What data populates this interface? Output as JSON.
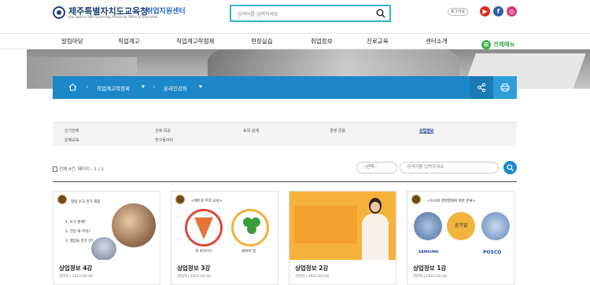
{
  "header": {
    "logo_ko": "제주특별자치도교육청",
    "logo_en": "Jeju Special Self-Governing Provincial Office of Education",
    "center_title": "취업지원센터",
    "search_placeholder": "검색어를 입력하세요",
    "login_label": "로그아웃",
    "sns": [
      {
        "name": "youtube",
        "glyph": "▶",
        "color": "#e02b20"
      },
      {
        "name": "facebook",
        "glyph": "f",
        "color": "#2d5faa"
      },
      {
        "name": "instagram",
        "glyph": "◎",
        "color": "#d8337a"
      }
    ]
  },
  "gnb": {
    "items": [
      "알림마당",
      "직업계고",
      "직업계고학점제",
      "현장실습",
      "취업정보",
      "진로교육",
      "센터소개"
    ],
    "all_menu": "전체메뉴"
  },
  "breadcrumb": {
    "level1": "직업계고학점제",
    "level2": "온라인강좌"
  },
  "categories": {
    "row1": [
      "인기전체",
      "건축 목공",
      "토목 설계",
      "경영 금융",
      "상업정보"
    ],
    "row2": [
      "원예교육",
      "연구동아리"
    ],
    "active": "상업정보"
  },
  "list": {
    "total_text": "전체 4건, 페이지 : 1 / 1",
    "select_label": "--선택--",
    "keyword_placeholder": "검색어를 입력하세요"
  },
  "cards": [
    {
      "title": "상업정보 4강",
      "meta": "관리자 | 2021-02-04",
      "bg": "#ffffff",
      "lines": [
        "협업 우고 한기 해줌",
        "1. 누가 판매?",
        "2. 전달 해 무엇?",
        "3. 협업을 받은 것?"
      ]
    },
    {
      "title": "상업정보 3강",
      "meta": "관리자 | 2021-02-04",
      "bg": "#ffffff",
      "lines": [
        "<매트로 추적 교육>",
        "객 비이어드",
        "클로버 및"
      ]
    },
    {
      "title": "상업정보 2강",
      "meta": "관리자 | 2021-02-04",
      "bg": "#f6b23a",
      "lines": []
    },
    {
      "title": "상업정보 1강",
      "meta": "관리자 | 2021-02-04",
      "bg": "#ffffff",
      "lines": [
        "<소모와 경영행태에 따른 분류>",
        "공기업",
        "SAMSUNG",
        "POSCO"
      ]
    }
  ]
}
